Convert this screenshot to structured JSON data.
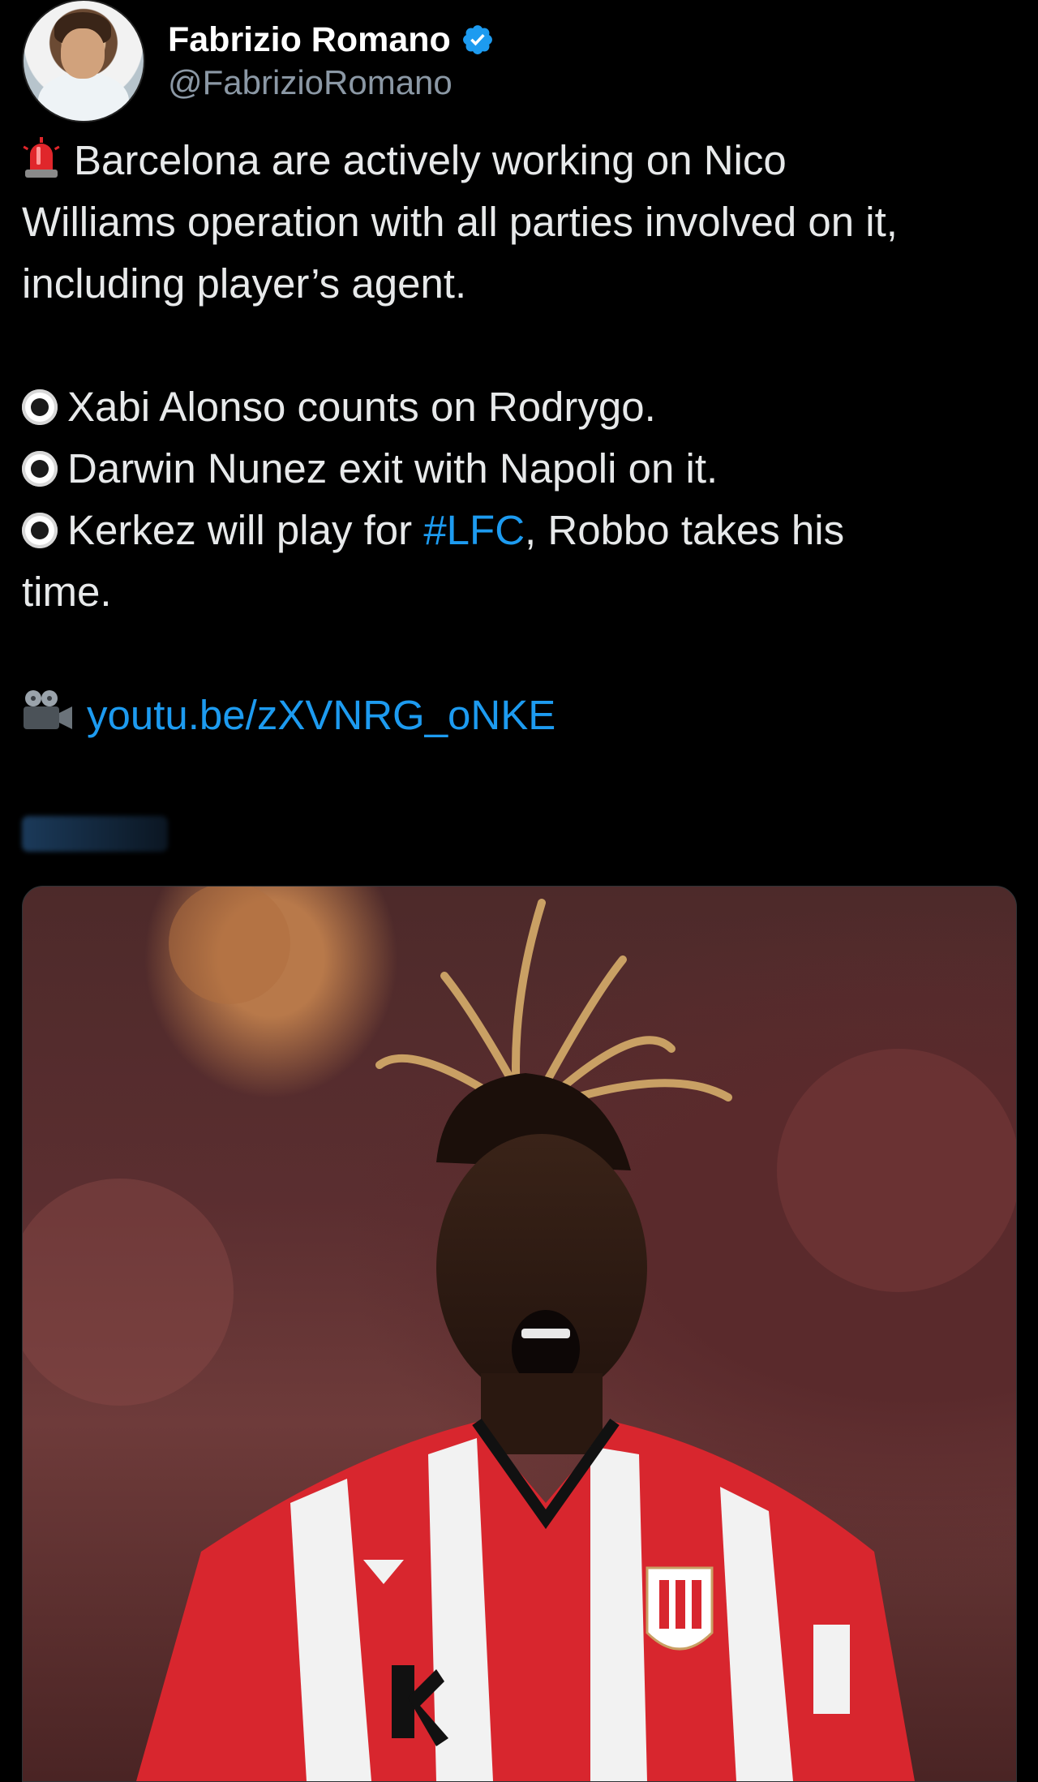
{
  "author": {
    "display_name": "Fabrizio Romano",
    "handle": "@FabrizioRomano",
    "avatar_icon": "avatar-photo",
    "verified_icon": "verified-badge-icon"
  },
  "tweet": {
    "line1": "Barcelona are actively working on Nico",
    "line2": "Williams operation with all parties involved on it,",
    "line3": "including player’s agent.",
    "bullet1": "Xabi Alonso counts on Rodrygo.",
    "bullet2": "Darwin Nunez exit with Napoli on it.",
    "bullet3_pre": "Kerkez will play for ",
    "bullet3_hashtag": "#LFC",
    "bullet3_post": ", Robbo takes his",
    "bullet3_cont": "time.",
    "video_link": "youtu.be/zXVNRG_oNKE"
  },
  "colors": {
    "background": "#000000",
    "text": "#e7e9ea",
    "link": "#1d9bf0",
    "handle": "#8b98a5",
    "verified": "#1d9bf0"
  }
}
